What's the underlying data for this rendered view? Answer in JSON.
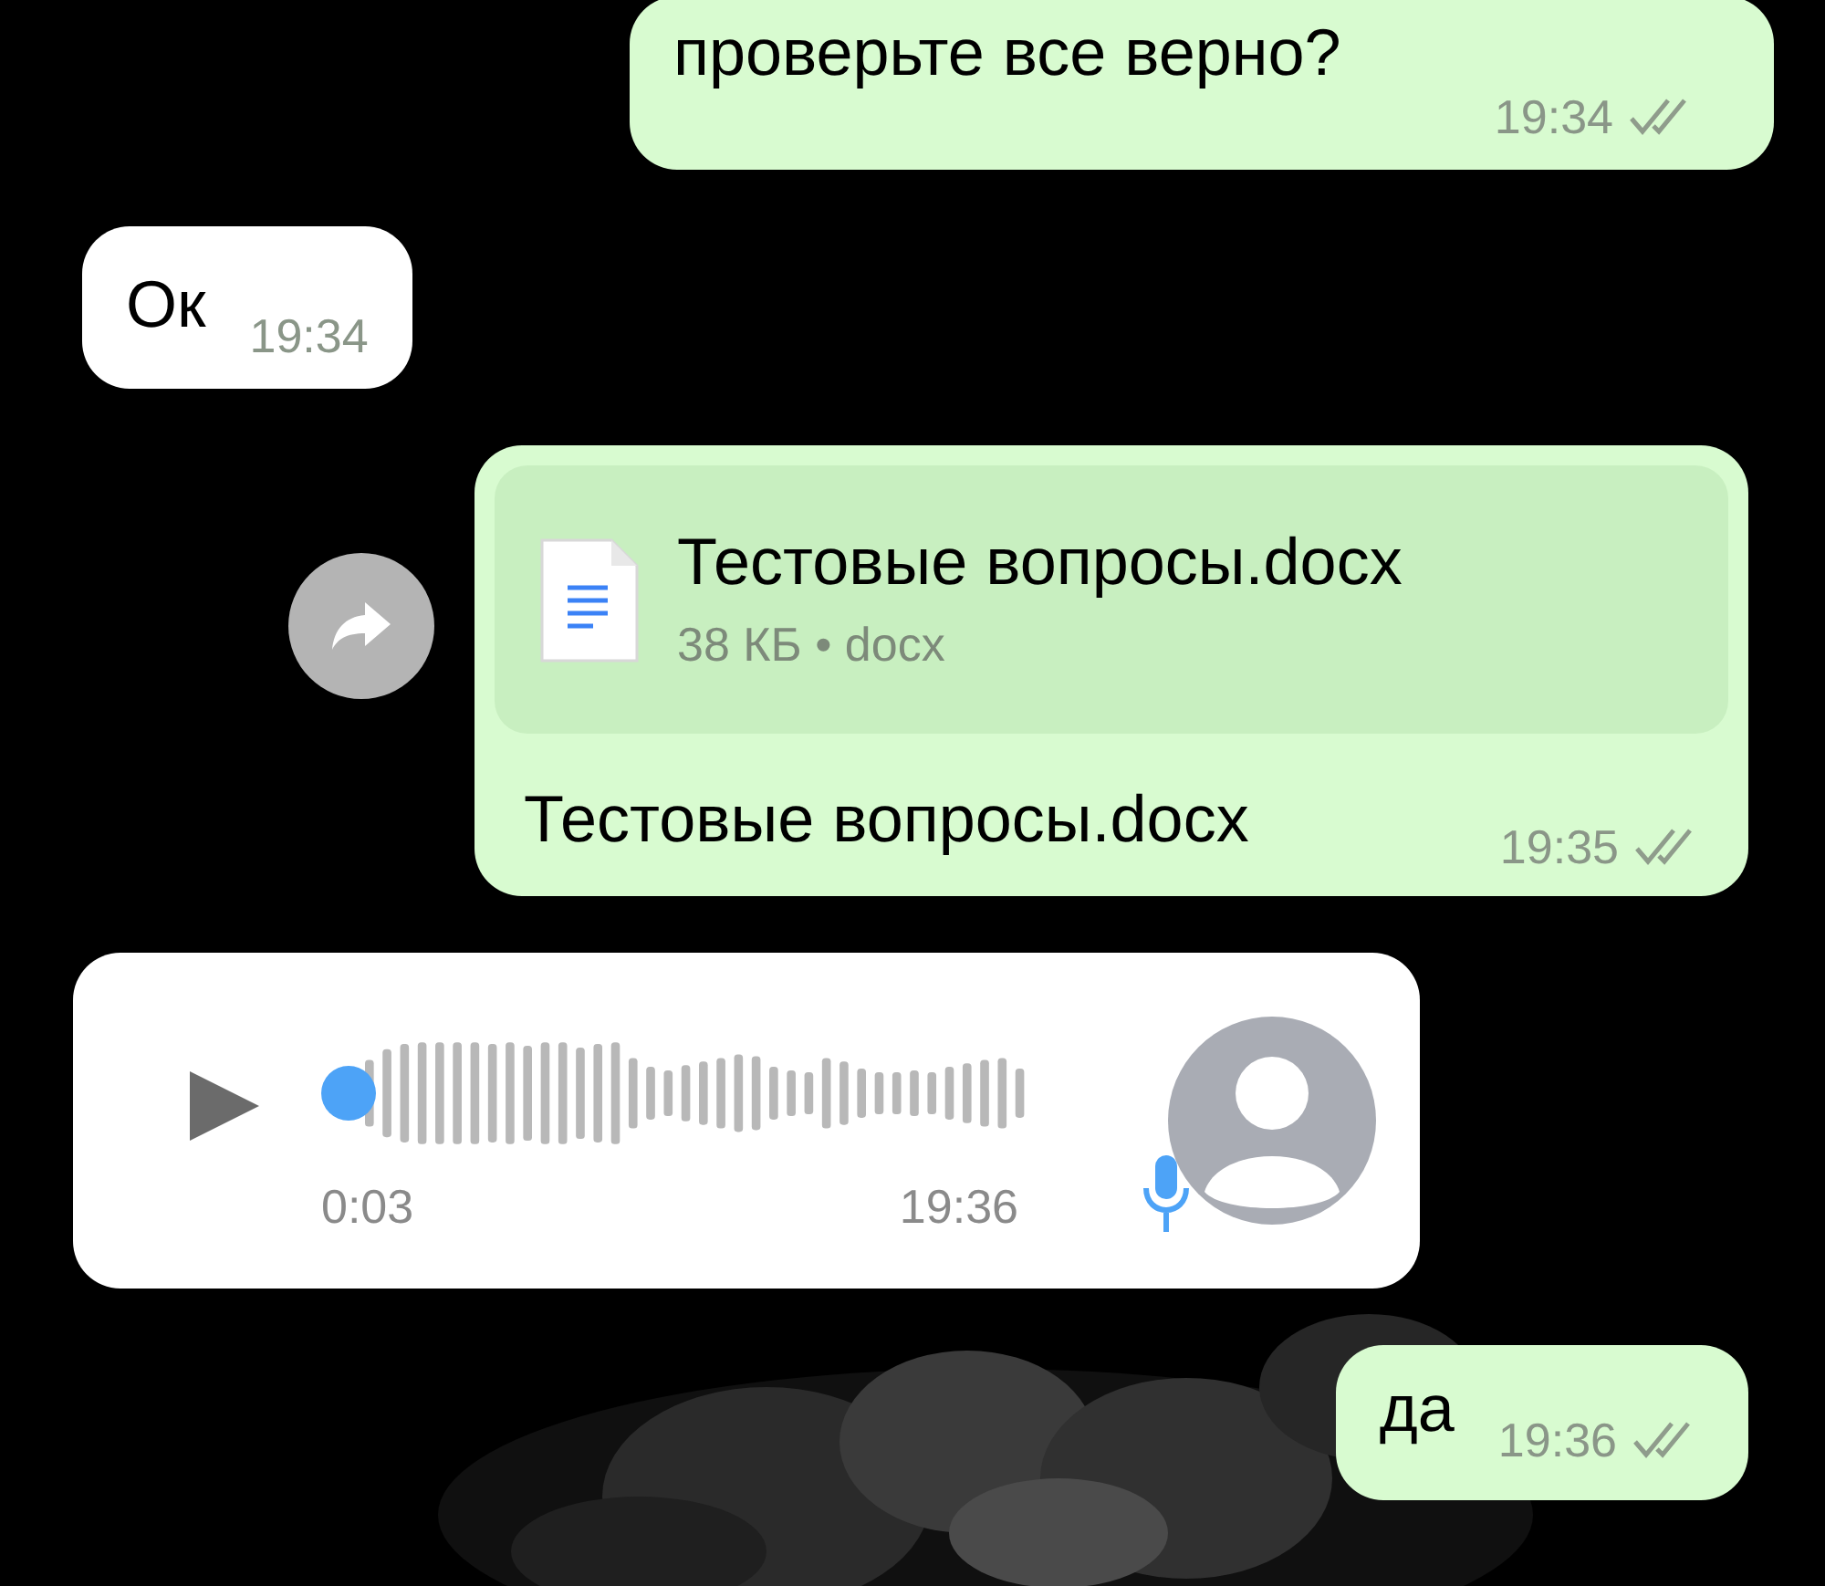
{
  "messages": [
    {
      "kind": "text",
      "outgoing": true,
      "text": "проверьте все верно?",
      "time": "19:34",
      "read": false
    },
    {
      "kind": "text",
      "outgoing": false,
      "text": "Ок",
      "time": "19:34"
    },
    {
      "kind": "document",
      "outgoing": true,
      "file_name": "Тестовые вопросы.docx",
      "file_info": "38 КБ • docx",
      "caption": "Тестовые вопросы.docx",
      "time": "19:35",
      "read": false
    },
    {
      "kind": "voice",
      "outgoing": false,
      "duration": "0:03",
      "time": "19:36"
    },
    {
      "kind": "text",
      "outgoing": true,
      "text": "да",
      "time": "19:36",
      "read": false
    }
  ]
}
